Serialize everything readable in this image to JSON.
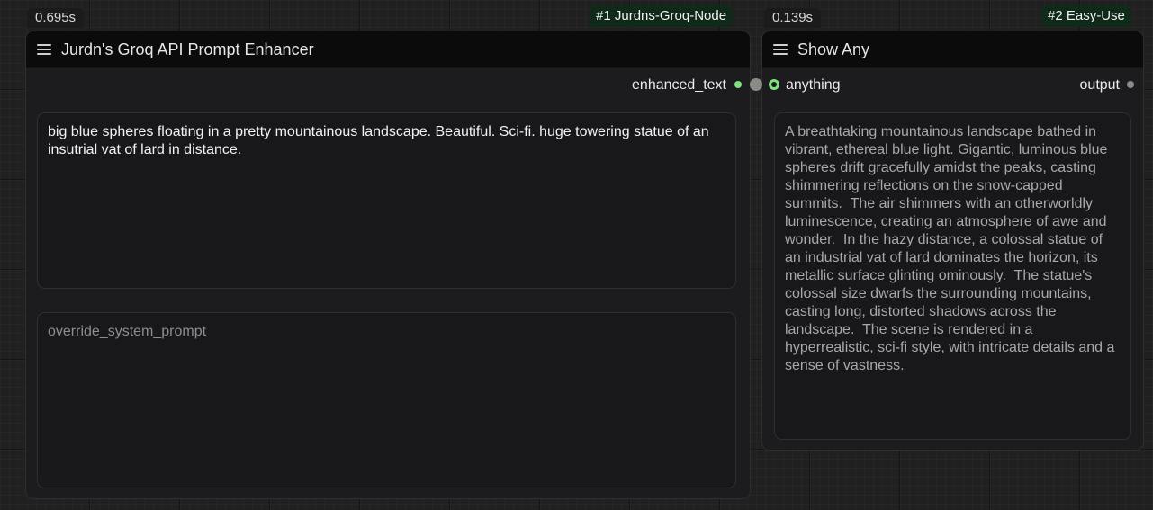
{
  "node1": {
    "time": "0.695s",
    "tag": "#1 Jurdns-Groq-Node",
    "title": "Jurdn's Groq API Prompt Enhancer",
    "output_label": "enhanced_text",
    "prompt_text": "big blue spheres floating in a pretty mountainous landscape. Beautiful. Sci-fi. huge towering statue of an insutrial vat of lard in distance.",
    "override_placeholder": "override_system_prompt"
  },
  "node2": {
    "time": "0.139s",
    "tag": "#2 Easy-Use",
    "title": "Show Any",
    "input_label": "anything",
    "output_label": "output",
    "display_text": "A breathtaking mountainous landscape bathed in vibrant, ethereal blue light. Gigantic, luminous blue spheres drift gracefully amidst the peaks, casting shimmering reflections on the snow-capped summits.  The air shimmers with an otherworldly luminescence, creating an atmosphere of awe and wonder.  In the hazy distance, a colossal statue of an industrial vat of lard dominates the horizon, its metallic surface glinting ominously.  The statue's colossal size dwarfs the surrounding mountains, casting long, distorted shadows across the landscape.  The scene is rendered in a hyperrealistic, sci-fi style, with intricate details and a sense of vastness."
  },
  "colors": {
    "connected_slot": "#7ee07e",
    "link": "#8a8a86",
    "unconnected_slot": "#8a8a8a",
    "tag_background": "#0f2a19"
  },
  "icons": {
    "node_menu": "hamburger-menu-icon"
  }
}
